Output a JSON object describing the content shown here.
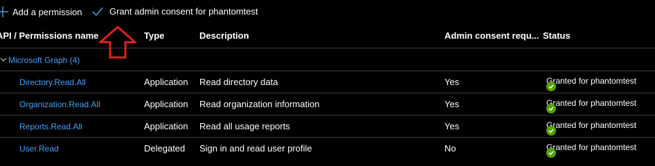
{
  "toolbar": {
    "add_label": "Add a permission",
    "grant_label": "Grant admin consent for phantomtest"
  },
  "table": {
    "headers": {
      "name": "API / Permissions name",
      "type": "Type",
      "description": "Description",
      "admin": "Admin consent requ...",
      "status": "Status"
    },
    "group": {
      "label": "Microsoft Graph (4)"
    },
    "rows": [
      {
        "name": "Directory.Read.All",
        "type": "Application",
        "description": "Read directory data",
        "admin": "Yes",
        "status": "Granted for phantomtest"
      },
      {
        "name": "Organization.Read.All",
        "type": "Application",
        "description": "Read organization information",
        "admin": "Yes",
        "status": "Granted for phantomtest"
      },
      {
        "name": "Reports.Read.All",
        "type": "Application",
        "description": "Read all usage reports",
        "admin": "Yes",
        "status": "Granted for phantomtest"
      },
      {
        "name": "User.Read",
        "type": "Delegated",
        "description": "Sign in and read user profile",
        "admin": "No",
        "status": "Granted for phantomtest"
      }
    ]
  },
  "colors": {
    "accent_link": "#4aa0f5",
    "success": "#57a300",
    "annotation_arrow": "#e02020"
  },
  "icons": {
    "add": "plus-icon",
    "grant": "checkmark-icon",
    "group_toggle": "chevron-down-icon",
    "status": "success-check-icon",
    "annotation": "up-arrow-annotation"
  }
}
